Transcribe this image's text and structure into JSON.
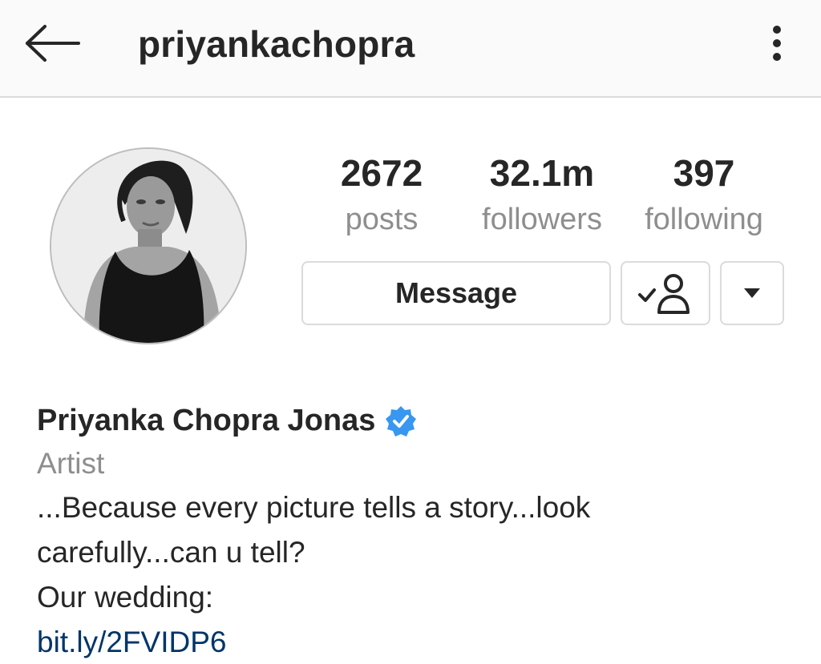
{
  "header": {
    "username": "priyankachopra"
  },
  "stats": {
    "posts": {
      "value": "2672",
      "label": "posts"
    },
    "followers": {
      "value": "32.1m",
      "label": "followers"
    },
    "following": {
      "value": "397",
      "label": "following"
    }
  },
  "actions": {
    "message_label": "Message"
  },
  "profile": {
    "full_name": "Priyanka Chopra Jonas",
    "verified": true,
    "category": "Artist",
    "bio_lines": [
      "...Because every picture tells a story...look",
      "carefully...can u tell?",
      "Our wedding:"
    ],
    "link": "bit.ly/2FVIDP6"
  },
  "icons": {
    "back": "arrow-left-icon",
    "more": "vertical-dots-icon",
    "following": "person-check-icon",
    "dropdown": "caret-down-icon",
    "verified": "verified-badge-icon"
  },
  "colors": {
    "text": "#262626",
    "secondary": "#8e8e8e",
    "border": "#dbdbdb",
    "link": "#003569",
    "verified": "#3897f0",
    "header_bg": "#fafafa"
  }
}
